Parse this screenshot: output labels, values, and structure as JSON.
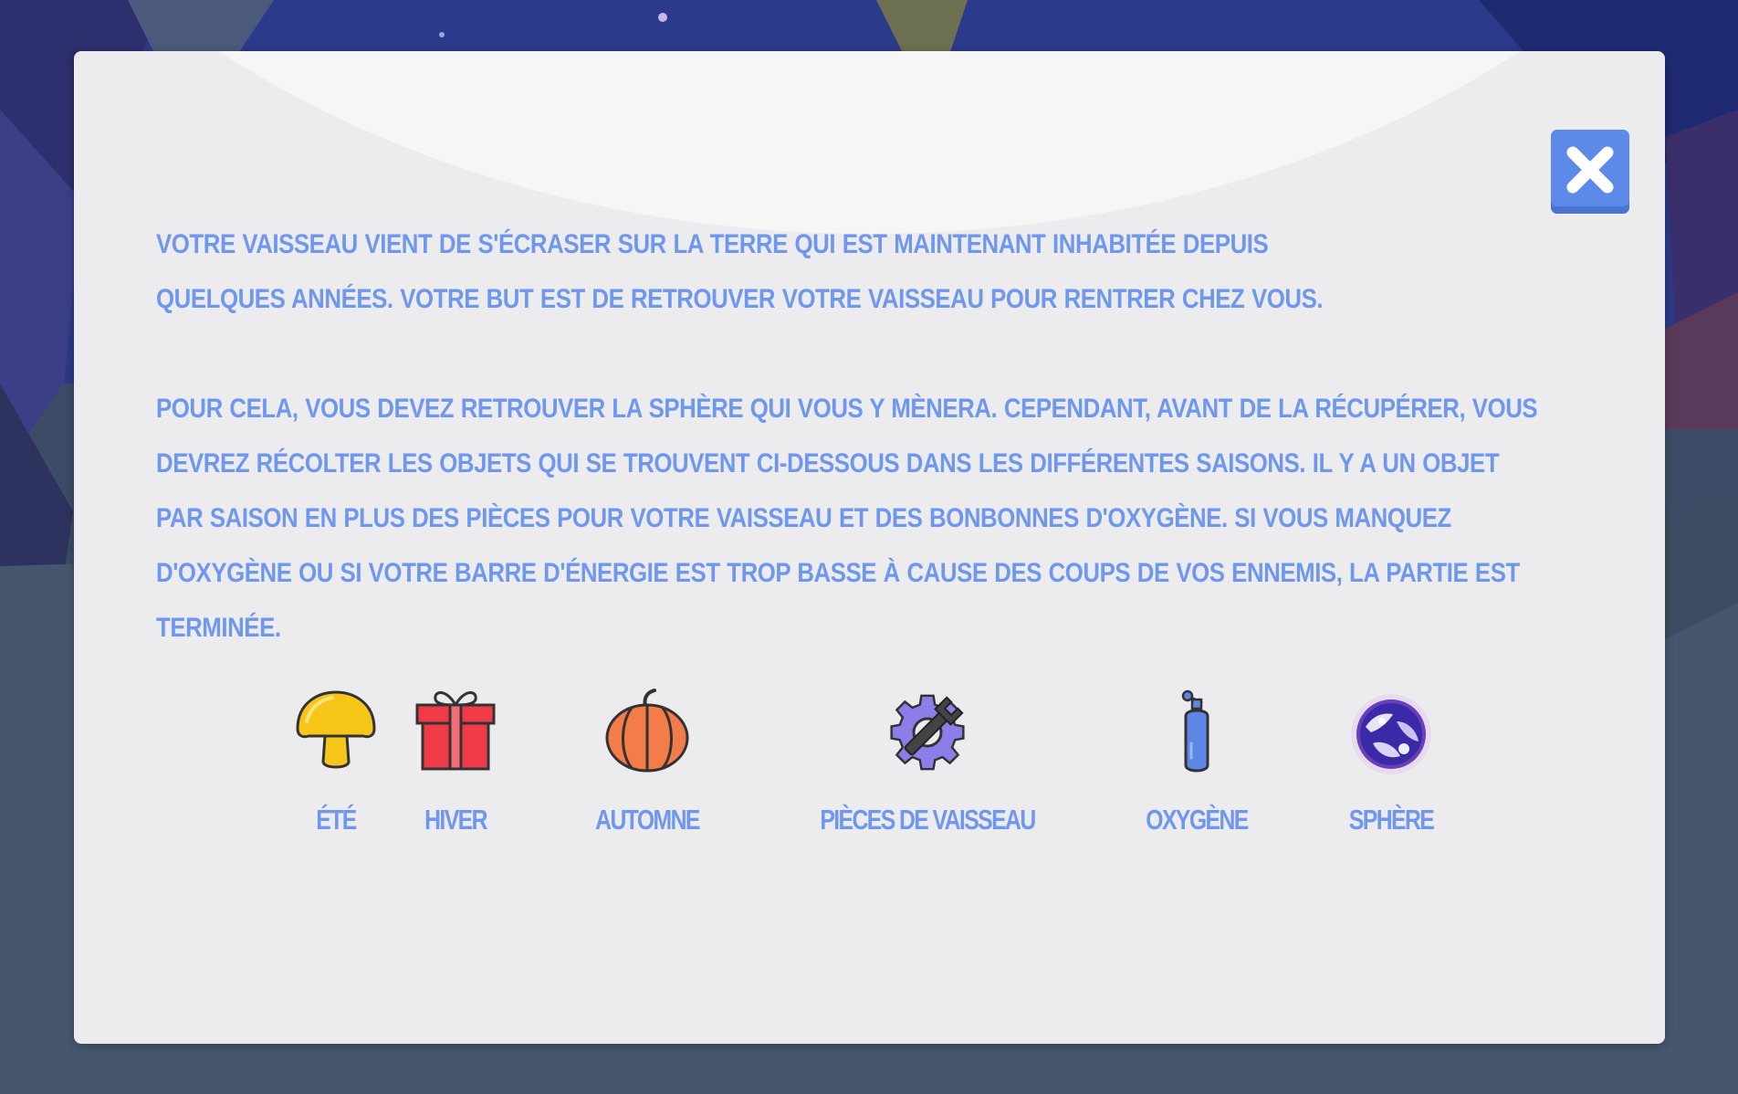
{
  "dialog": {
    "close_icon": "close-x-icon",
    "intro_text": "Votre vaisseau vient de s'écraser sur la Terre qui est maintenant inhabitée depuis quelques années. Votre but est de retrouver votre vaisseau pour rentrer chez vous.",
    "rules_text": "Pour cela, vous devez retrouver la sphère qui vous y mènera. Cependant, avant de la récupérer, vous devrez récolter les objets qui se trouvent ci-dessous dans les différentes saisons. Il y a un objet par saison en plus des pièces pour votre vaisseau et des bonbonnes d'oxygène. Si vous manquez d'oxygène ou si votre barre d'énergie est trop basse à cause des coups de vos ennemis, la partie est terminée."
  },
  "items": [
    {
      "label": "ÉTÉ",
      "icon": "mushroom-icon",
      "color": "#f5c518"
    },
    {
      "label": "HIVER",
      "icon": "gift-icon",
      "color": "#ee3b47"
    },
    {
      "label": "AUTOMNE",
      "icon": "pumpkin-icon",
      "color": "#f47c4a"
    },
    {
      "label": "PIÈCES DE VAISSEAU",
      "icon": "gear-wrench-icon",
      "color": "#8c7ee8"
    },
    {
      "label": "OXYGÈNE",
      "icon": "oxygen-tank-icon",
      "color": "#5d86e6"
    },
    {
      "label": "SPHÈRE",
      "icon": "sphere-icon",
      "color": "#6b3fb7"
    }
  ],
  "colors": {
    "text": "#6f97ee",
    "panel": "#ececee",
    "close_button": "#5d8ae8"
  }
}
